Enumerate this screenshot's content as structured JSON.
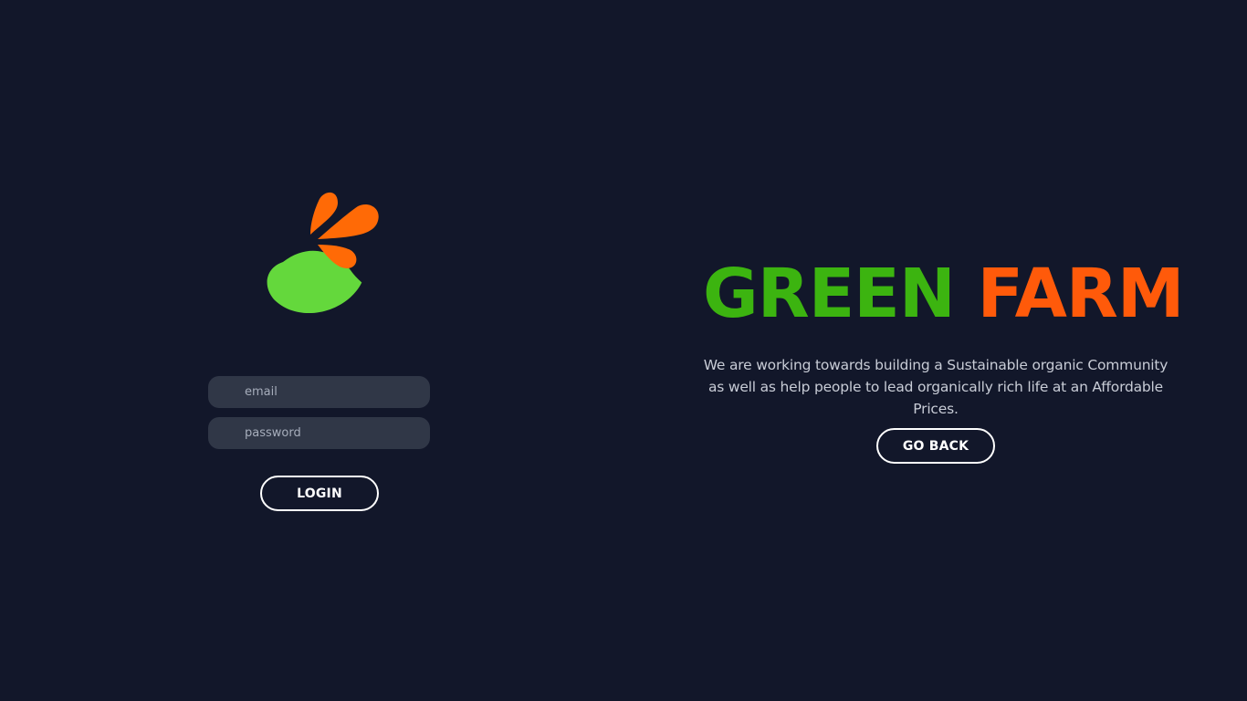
{
  "brand": {
    "title_part1": "GREEN",
    "title_part2": "FARM",
    "description": "We are working towards building a Sustainable organic Community as well as help people to lead organically rich life at an Affordable Prices."
  },
  "login_form": {
    "email_placeholder": "email",
    "password_placeholder": "password",
    "login_label": "LOGIN"
  },
  "actions": {
    "go_back_label": "GO BACK"
  },
  "colors": {
    "background": "#12172a",
    "brand_green": "#3cb410",
    "brand_orange": "#ff5a0a",
    "input_background": "#303747",
    "logo_green": "#64d83c",
    "logo_orange": "#ff6a06"
  },
  "icons": {
    "logo": "green-farm-leaf-logo-icon"
  }
}
